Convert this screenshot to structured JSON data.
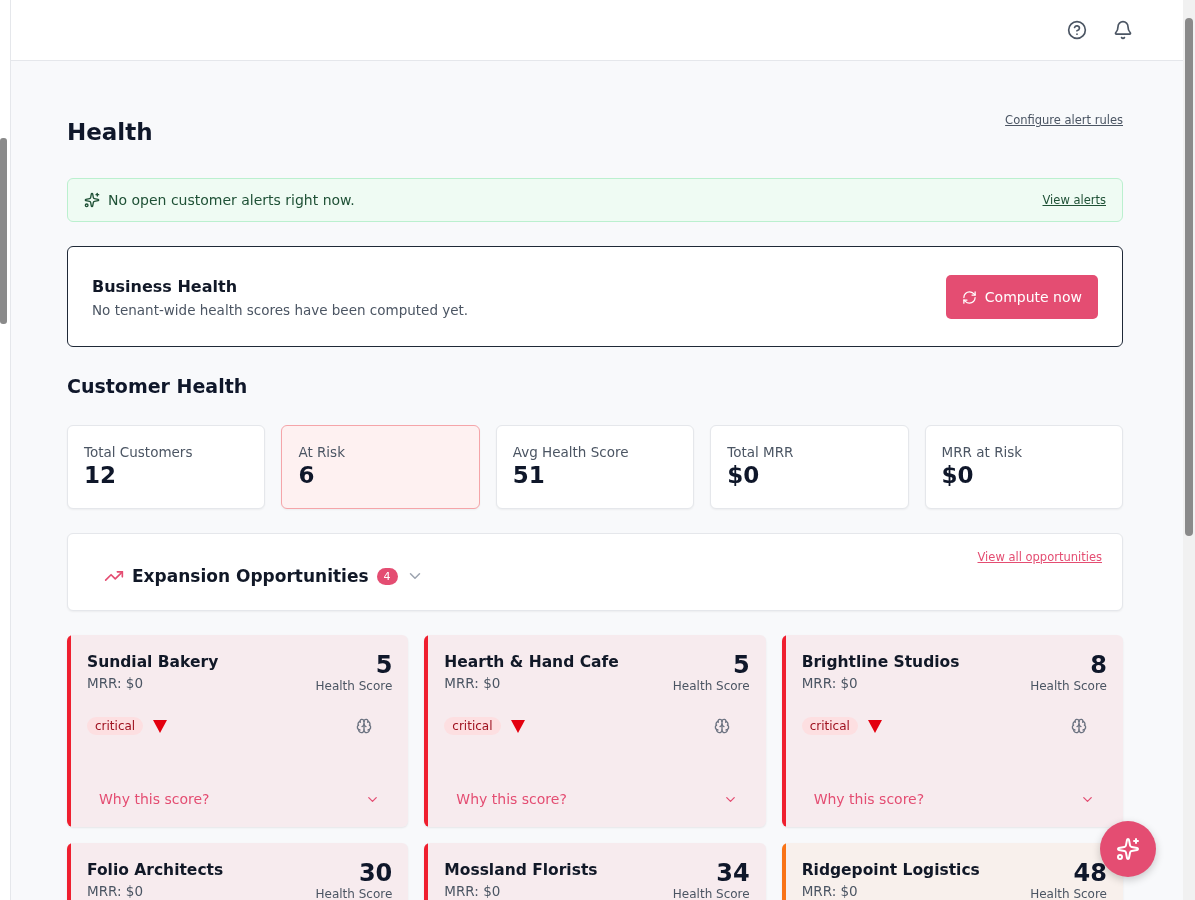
{
  "page": {
    "title": "Health",
    "configure_link": "Configure alert rules"
  },
  "alert_banner": {
    "message": "No open customer alerts right now.",
    "link": "View alerts"
  },
  "business_health": {
    "title": "Business Health",
    "message": "No tenant-wide health scores have been computed yet.",
    "button": "Compute now"
  },
  "customer_health": {
    "title": "Customer Health",
    "stats": [
      {
        "label": "Total Customers",
        "value": "12",
        "highlighted": false
      },
      {
        "label": "At Risk",
        "value": "6",
        "highlighted": true
      },
      {
        "label": "Avg Health Score",
        "value": "51",
        "highlighted": false
      },
      {
        "label": "Total MRR",
        "value": "$0",
        "highlighted": false
      },
      {
        "label": "MRR at Risk",
        "value": "$0",
        "highlighted": false
      }
    ]
  },
  "expansion": {
    "title": "Expansion Opportunities",
    "count": "4",
    "expanded": false,
    "link": "View all opportunities"
  },
  "customers": [
    {
      "name": "Sundial Bakery",
      "mrr": "MRR: $0",
      "score": "5",
      "score_label": "Health Score",
      "color": "#ef1f2f",
      "badge": "critical",
      "trend_down": true,
      "why": "Why this score?"
    },
    {
      "name": "Hearth & Hand Cafe",
      "mrr": "MRR: $0",
      "score": "5",
      "score_label": "Health Score",
      "color": "#ef1f2f",
      "badge": "critical",
      "trend_down": true,
      "why": "Why this score?"
    },
    {
      "name": "Brightline Studios",
      "mrr": "MRR: $0",
      "score": "8",
      "score_label": "Health Score",
      "color": "#ef1f2f",
      "badge": "critical",
      "trend_down": true,
      "why": "Why this score?"
    },
    {
      "name": "Folio Architects",
      "mrr": "MRR: $0",
      "score": "30",
      "score_label": "Health Score",
      "color": "#ef1f2f"
    },
    {
      "name": "Mossland Florists",
      "mrr": "MRR: $0",
      "score": "34",
      "score_label": "Health Score",
      "color": "#ef1f2f"
    },
    {
      "name": "Ridgepoint Logistics",
      "mrr": "MRR: $0",
      "score": "48",
      "score_label": "Health Score",
      "color": "#f97316"
    }
  ]
}
